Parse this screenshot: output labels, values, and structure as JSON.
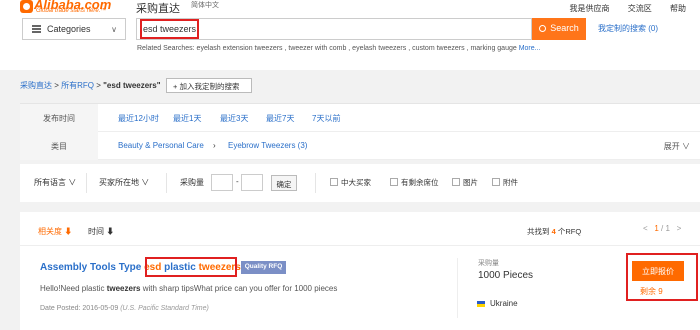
{
  "header": {
    "logo": {
      "name": "Alibaba.com",
      "tagline": "Global trade starts here.™"
    },
    "sub_brand": "采购直达",
    "language": "简体中文",
    "top_links": [
      "我是供应商",
      "交流区",
      "帮助"
    ]
  },
  "search": {
    "category_label": "Categories",
    "query": "esd tweezers",
    "button_label": "Search",
    "custom_search_link": "我定制的搜索 (0)",
    "related_label": "Related Searches:",
    "related_terms": "eyelash extension tweezers , tweezer with comb , eyelash tweezers , custom tweezers , marking gauge",
    "related_more": "More..."
  },
  "breadcrumb": {
    "items": [
      "采购直达",
      "所有RFQ"
    ],
    "current": "\"esd tweezers\"",
    "add_button": "+ 加入我定制的搜索"
  },
  "filters": {
    "time_label": "发布时间",
    "time_options": [
      "最近12小时",
      "最近1天",
      "最近3天",
      "最近7天",
      "7天以前"
    ],
    "category_label": "类目",
    "category_values": [
      "Beauty & Personal Care",
      "Eyebrow Tweezers (3)"
    ],
    "expand": "展开"
  },
  "refine": {
    "all_languages": "所有语言",
    "buyer_location": "买家所在地",
    "quantity_label": "采购量",
    "range_sep": "-",
    "confirm": "确定",
    "checkboxes": [
      "中大买家",
      "有剩余席位",
      "图片",
      "附件"
    ]
  },
  "results": {
    "sort_relevance": "相关度 ⬇",
    "sort_time": "时间 ⬇",
    "found_prefix": "共找到",
    "found_count": "4",
    "found_suffix": "个RFQ",
    "pager_prev": "<",
    "pager_current": "1",
    "pager_sep": "/",
    "pager_total": "1",
    "pager_next": ">",
    "item": {
      "title_prefix": "Assembly Tools Type ",
      "title_esd": "esd",
      "title_mid": " plastic ",
      "title_tweezers": "tweezers",
      "badge": "Quality RFQ",
      "desc_prefix": "Hello!Need plastic ",
      "desc_bold": "tweezers",
      "desc_suffix": " with sharp tipsWhat price can you offer for 1000 pieces",
      "date_label": "Date Posted: 2016-05-09",
      "date_tz": "(U.S. Pacific Standard Time)",
      "quantity_label": "采购量",
      "quantity_value": "1000 Pieces",
      "country": "Ukraine",
      "quote_button": "立即报价",
      "quote_sub": "剩余 9"
    }
  },
  "colors": {
    "accent": "#ff6a00",
    "link": "#2a6fc9",
    "highlight_box": "#e02020",
    "badge": "#7b8fc6"
  }
}
